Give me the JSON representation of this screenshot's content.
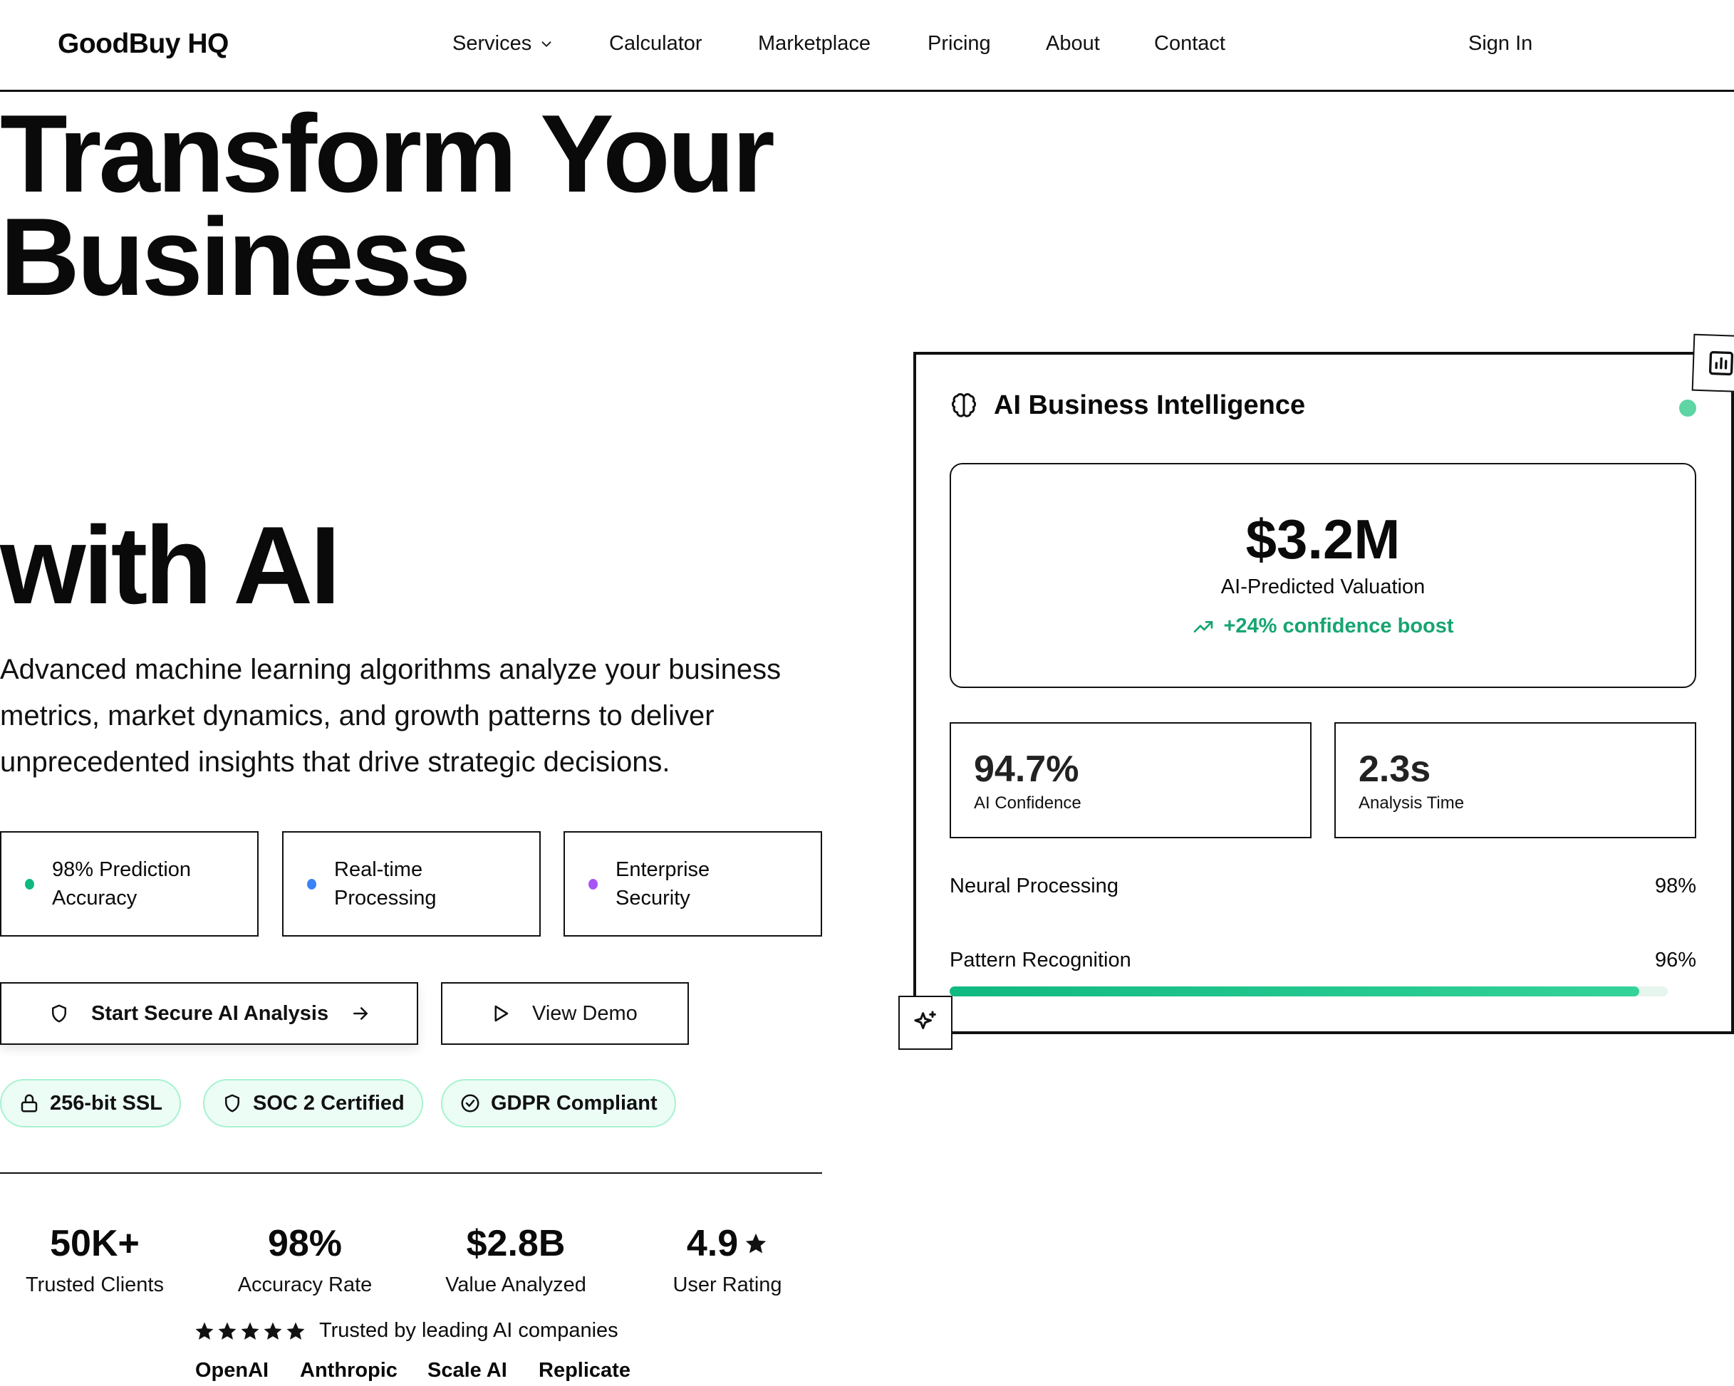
{
  "nav": {
    "brand": "GoodBuy HQ",
    "items": [
      "Services",
      "Calculator",
      "Marketplace",
      "Pricing",
      "About",
      "Contact"
    ],
    "sign_in": "Sign In"
  },
  "hero": {
    "title_line1": "Transform Your",
    "title_line2": "Business",
    "title_line3": "with AI",
    "lede": "Advanced machine learning algorithms analyze your business metrics, market dynamics, and growth patterns to deliver unprecedented insights that drive strategic decisions.",
    "features": [
      {
        "label": "98% Prediction Accuracy",
        "color": "#10b981"
      },
      {
        "label": "Real-time Processing",
        "color": "#3b82f6"
      },
      {
        "label": "Enterprise Security",
        "color": "#a855f7"
      }
    ],
    "primary_button": "Start Secure AI Analysis",
    "secondary_button": "View Demo",
    "badges": [
      "256-bit SSL",
      "SOC 2 Certified",
      "GDPR Compliant"
    ],
    "stats": [
      {
        "value": "50K+",
        "label": "Trusted Clients"
      },
      {
        "value": "98%",
        "label": "Accuracy Rate"
      },
      {
        "value": "$2.8B",
        "label": "Value Analyzed"
      },
      {
        "value": "4.9",
        "label": "User Rating"
      }
    ],
    "trust_text": "Trusted by leading AI companies",
    "trust_rating_stars": 5,
    "companies": [
      "OpenAI",
      "Anthropic",
      "Scale AI",
      "Replicate"
    ]
  },
  "card": {
    "title": "AI Business Intelligence",
    "valuation": "$3.2M",
    "valuation_label": "AI-Predicted Valuation",
    "boost": "+24% confidence boost",
    "metrics": [
      {
        "value": "94.7%",
        "label": "AI Confidence"
      },
      {
        "value": "2.3s",
        "label": "Analysis Time"
      }
    ],
    "progress": [
      {
        "label": "Neural Processing",
        "value_text": "98%"
      },
      {
        "label": "Pattern Recognition",
        "value_text": "96%",
        "level": 0.96
      }
    ],
    "accent": "#10b981",
    "status_color": "#5fd4a4"
  }
}
